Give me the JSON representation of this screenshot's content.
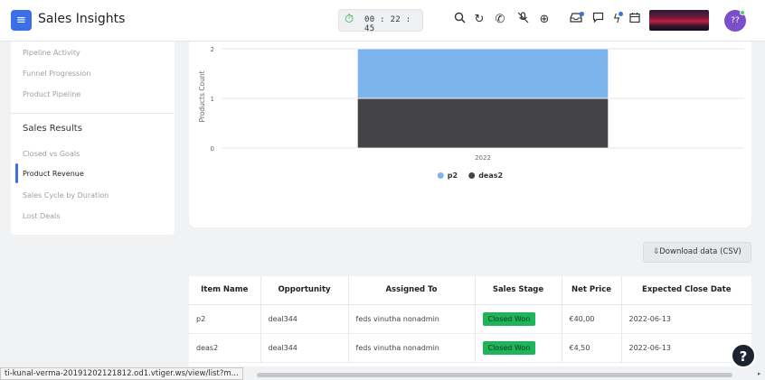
{
  "header": {
    "menu_icon": "≡",
    "app_title": "Sales Insights",
    "timer": "00 : 22 : 45",
    "avatar_initials": "??"
  },
  "icons": {
    "timer": "stopwatch-icon",
    "search": "search-icon",
    "history": "history-icon",
    "phone": "phone-icon",
    "mute": "mute-icon",
    "add": "plus-circle-icon",
    "inbox": "inbox-icon",
    "chat": "chat-icon",
    "bolt": "bolt-icon",
    "calendar": "calendar-icon",
    "download": "download-icon",
    "help": "help-icon"
  },
  "sidebar": {
    "items_top": [
      "Pipeline Activity",
      "Funnel Progression",
      "Product Pipeline"
    ],
    "section_title": "Sales Results",
    "items": [
      "Closed vs Goals",
      "Product Revenue",
      "Sales Cycle by Duration",
      "Lost Deals"
    ],
    "active_item": "Product Revenue"
  },
  "chart_data": {
    "type": "bar",
    "stacked": true,
    "categories": [
      "2022"
    ],
    "series": [
      {
        "name": "deas2",
        "values": [
          1
        ],
        "color": "#434348"
      },
      {
        "name": "p2",
        "values": [
          1
        ],
        "color": "#7cb5ec"
      }
    ],
    "ylabel": "Products Count",
    "xlabel": "",
    "ylim": [
      0,
      2
    ],
    "yticks": [
      0,
      1,
      2
    ],
    "legend": [
      "p2",
      "deas2"
    ],
    "legend_position": "bottom",
    "grid": true
  },
  "download_label": "Download data (CSV)",
  "table": {
    "headers": [
      "Item Name",
      "Opportunity",
      "Assigned To",
      "Sales Stage",
      "Net Price",
      "Expected Close Date"
    ],
    "rows": [
      [
        "p2",
        "deal344",
        "feds vinutha nonadmin",
        "Closed Won",
        "€40,00",
        "2022-06-13"
      ],
      [
        "deas2",
        "deal344",
        "feds vinutha nonadmin",
        "Closed Won",
        "€4,50",
        "2022-06-13"
      ]
    ]
  },
  "help_label": "?",
  "status_url": "ti-kunal-verma-20191202121812.od1.vtiger.ws/view/list?m..."
}
